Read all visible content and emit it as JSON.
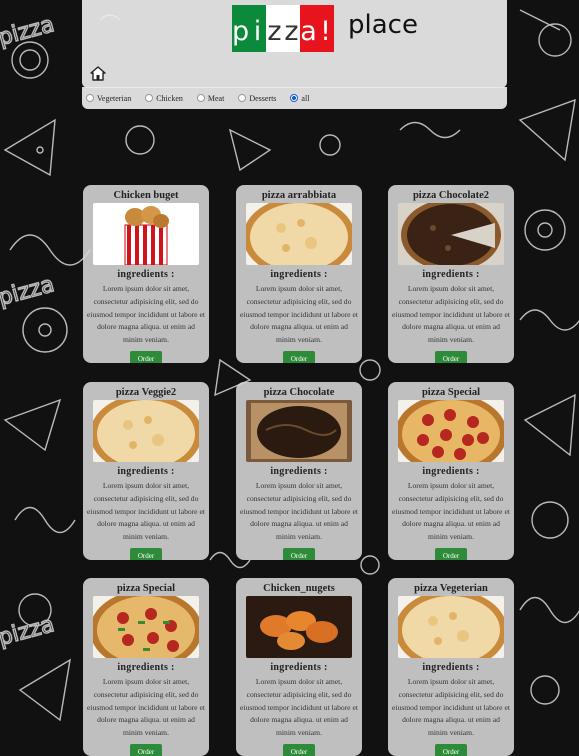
{
  "header": {
    "logo_letters": [
      "p",
      "i",
      "z",
      "z",
      "a",
      "!"
    ],
    "logo_tail": "place"
  },
  "filters": [
    {
      "label": "Vegeterian",
      "checked": false
    },
    {
      "label": "Chicken",
      "checked": false
    },
    {
      "label": "Meat",
      "checked": false
    },
    {
      "label": "Desserts",
      "checked": false
    },
    {
      "label": "all",
      "checked": true
    }
  ],
  "menu": {
    "ingredients_label": "ingredients :",
    "description": "Lorem ipsum dolor sit amet, consectetur adipisicing elit, sed do eiusmod tempor incididunt ut labore et dolore magna aliqua. ut enim ad minim veniam.",
    "order_label": "Order",
    "items": [
      {
        "title": "Chicken buget",
        "image": "chicken-bucket"
      },
      {
        "title": "pizza arrabbiata",
        "image": "cheese-pizza"
      },
      {
        "title": "pizza Chocolate2",
        "image": "chocolate-pizza-slice"
      },
      {
        "title": "pizza Veggie2",
        "image": "cheese-pizza"
      },
      {
        "title": "pizza Chocolate",
        "image": "chocolate-pizza-box"
      },
      {
        "title": "pizza Special",
        "image": "pepperoni-pizza"
      },
      {
        "title": "pizza Special",
        "image": "supreme-pizza"
      },
      {
        "title": "Chicken_nugets",
        "image": "chicken-nuggets"
      },
      {
        "title": "pizza Vegeterian",
        "image": "cheese-pizza"
      }
    ]
  },
  "colors": {
    "green": "#0a8a3a",
    "red": "#e8141d",
    "order": "#2e8b3a"
  }
}
